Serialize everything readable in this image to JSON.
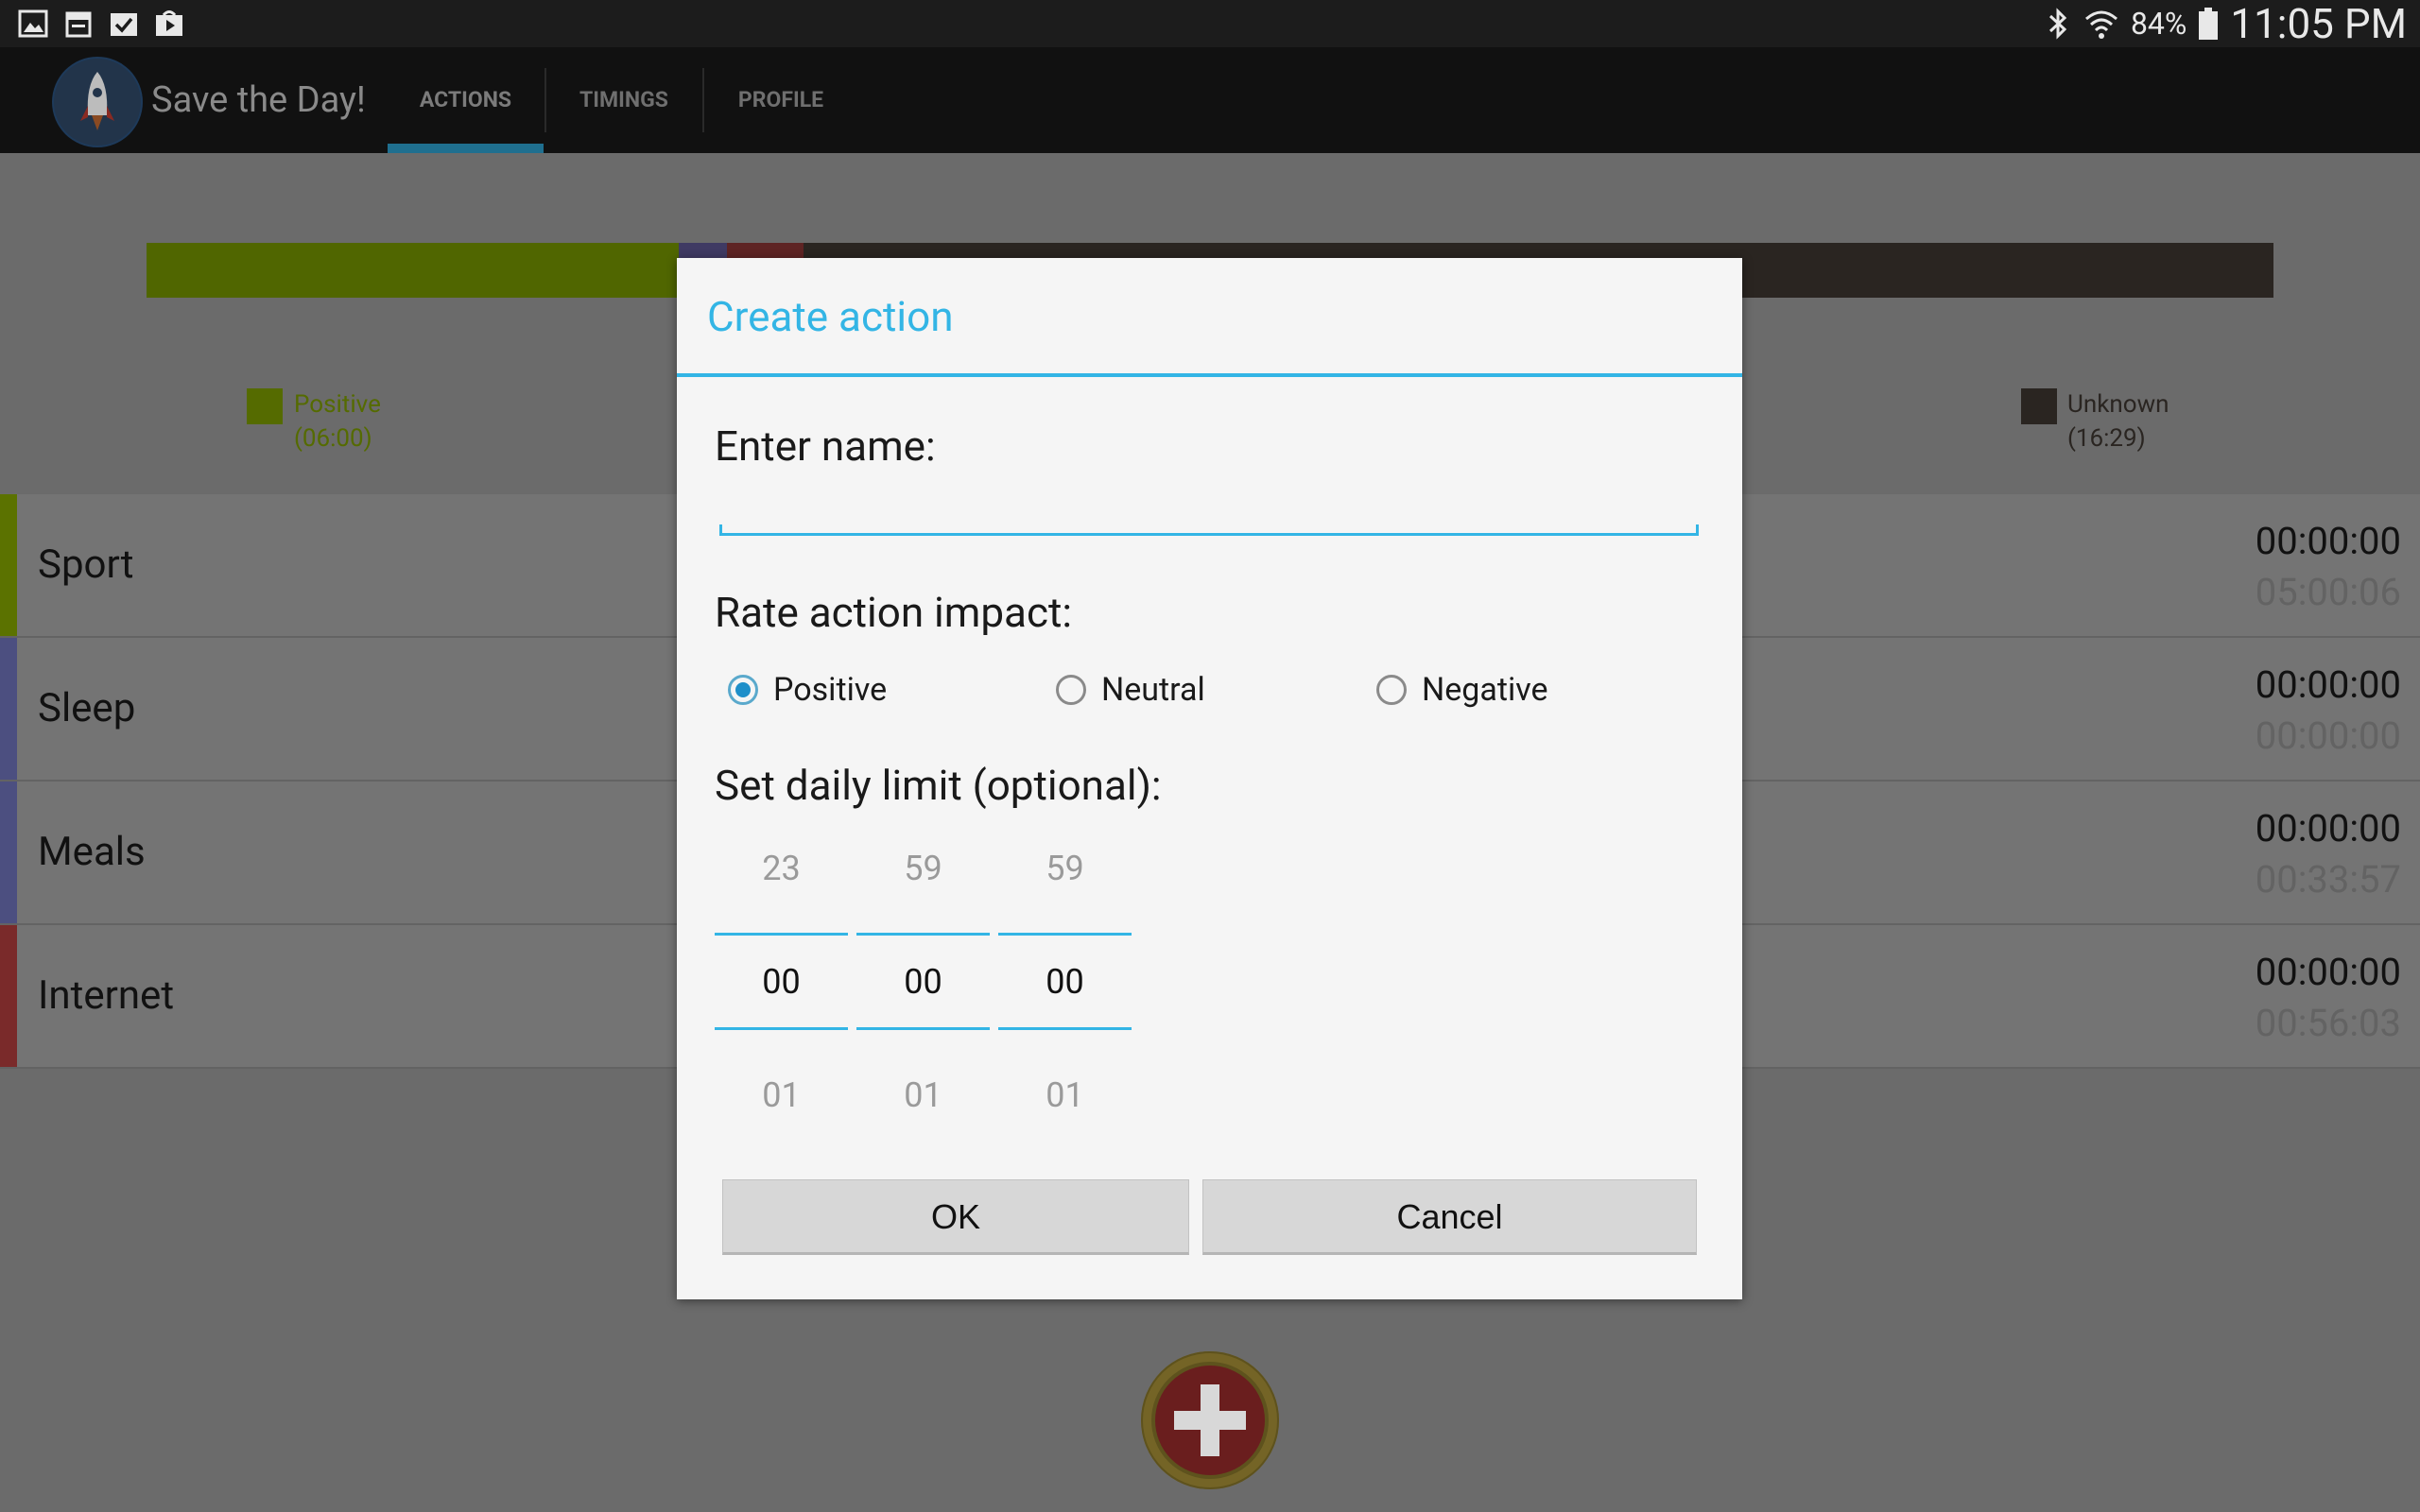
{
  "status_bar": {
    "left_icons": [
      "gallery-icon",
      "calendar-icon",
      "checklist-icon",
      "play-store-icon"
    ],
    "right_icons": [
      "bluetooth-icon",
      "wifi-icon",
      "battery-icon"
    ],
    "battery": "84%",
    "time": "11:05 PM"
  },
  "action_bar": {
    "app_title": "Save the Day!",
    "tabs": [
      {
        "label": "ACTIONS",
        "selected": true
      },
      {
        "label": "TIMINGS",
        "selected": false
      },
      {
        "label": "PROFILE",
        "selected": false
      }
    ]
  },
  "timeline": {
    "segments": [
      {
        "name": "positive",
        "share": 0.25,
        "color": "#506600"
      },
      {
        "name": "neutral",
        "share": 0.023,
        "color": "#3f3a63"
      },
      {
        "name": "negative",
        "share": 0.036,
        "color": "#5e2424"
      },
      {
        "name": "unknown",
        "share": 0.691,
        "color": "#2a2521"
      }
    ]
  },
  "legend": {
    "positive": {
      "label": "Positive",
      "time": "(06:00)",
      "color": "#556b00"
    },
    "unknown": {
      "label": "Unknown",
      "time": "(16:29)",
      "color": "#2a2521"
    }
  },
  "actions": [
    {
      "name": "Sport",
      "time_today": "00:00:00",
      "time_total": "05:00:06",
      "color": "#5b7200"
    },
    {
      "name": "Sleep",
      "time_today": "00:00:00",
      "time_total": "00:00:00",
      "color": "#4c4f80"
    },
    {
      "name": "Meals",
      "time_today": "00:00:00",
      "time_total": "00:33:57",
      "color": "#4c4f80"
    },
    {
      "name": "Internet",
      "time_today": "00:00:00",
      "time_total": "00:56:03",
      "color": "#7a2a2a"
    }
  ],
  "dialog": {
    "title": "Create action",
    "name_label": "Enter name:",
    "name_value": "",
    "impact_label": "Rate action impact:",
    "impact_options": [
      {
        "label": "Positive",
        "checked": true
      },
      {
        "label": "Neutral",
        "checked": false
      },
      {
        "label": "Negative",
        "checked": false
      }
    ],
    "limit_label": "Set daily limit (optional):",
    "picker": {
      "hours": {
        "prev": "23",
        "current": "00",
        "next": "01"
      },
      "minutes": {
        "prev": "59",
        "current": "00",
        "next": "01"
      },
      "seconds": {
        "prev": "59",
        "current": "00",
        "next": "01"
      }
    },
    "ok_label": "OK",
    "cancel_label": "Cancel"
  },
  "colors": {
    "accent": "#33b5e5",
    "radio_checked": "#1f8fc9",
    "add_button": "#746426"
  }
}
